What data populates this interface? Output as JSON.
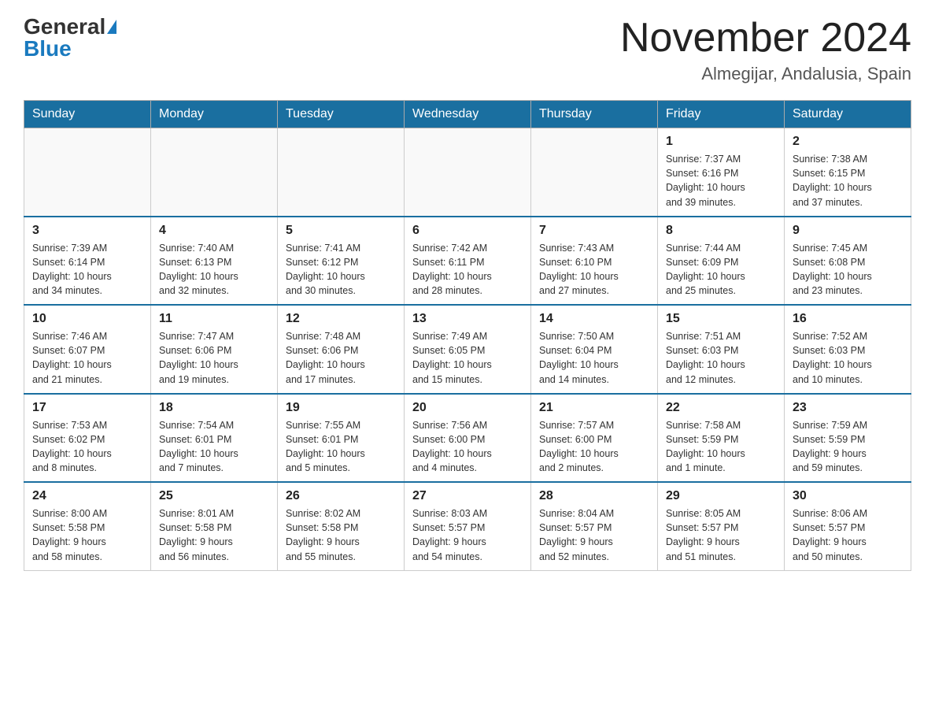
{
  "header": {
    "logo_general": "General",
    "logo_blue": "Blue",
    "month_title": "November 2024",
    "location": "Almegijar, Andalusia, Spain"
  },
  "days_of_week": [
    "Sunday",
    "Monday",
    "Tuesday",
    "Wednesday",
    "Thursday",
    "Friday",
    "Saturday"
  ],
  "weeks": [
    {
      "days": [
        {
          "num": "",
          "info": ""
        },
        {
          "num": "",
          "info": ""
        },
        {
          "num": "",
          "info": ""
        },
        {
          "num": "",
          "info": ""
        },
        {
          "num": "",
          "info": ""
        },
        {
          "num": "1",
          "info": "Sunrise: 7:37 AM\nSunset: 6:16 PM\nDaylight: 10 hours\nand 39 minutes."
        },
        {
          "num": "2",
          "info": "Sunrise: 7:38 AM\nSunset: 6:15 PM\nDaylight: 10 hours\nand 37 minutes."
        }
      ]
    },
    {
      "days": [
        {
          "num": "3",
          "info": "Sunrise: 7:39 AM\nSunset: 6:14 PM\nDaylight: 10 hours\nand 34 minutes."
        },
        {
          "num": "4",
          "info": "Sunrise: 7:40 AM\nSunset: 6:13 PM\nDaylight: 10 hours\nand 32 minutes."
        },
        {
          "num": "5",
          "info": "Sunrise: 7:41 AM\nSunset: 6:12 PM\nDaylight: 10 hours\nand 30 minutes."
        },
        {
          "num": "6",
          "info": "Sunrise: 7:42 AM\nSunset: 6:11 PM\nDaylight: 10 hours\nand 28 minutes."
        },
        {
          "num": "7",
          "info": "Sunrise: 7:43 AM\nSunset: 6:10 PM\nDaylight: 10 hours\nand 27 minutes."
        },
        {
          "num": "8",
          "info": "Sunrise: 7:44 AM\nSunset: 6:09 PM\nDaylight: 10 hours\nand 25 minutes."
        },
        {
          "num": "9",
          "info": "Sunrise: 7:45 AM\nSunset: 6:08 PM\nDaylight: 10 hours\nand 23 minutes."
        }
      ]
    },
    {
      "days": [
        {
          "num": "10",
          "info": "Sunrise: 7:46 AM\nSunset: 6:07 PM\nDaylight: 10 hours\nand 21 minutes."
        },
        {
          "num": "11",
          "info": "Sunrise: 7:47 AM\nSunset: 6:06 PM\nDaylight: 10 hours\nand 19 minutes."
        },
        {
          "num": "12",
          "info": "Sunrise: 7:48 AM\nSunset: 6:06 PM\nDaylight: 10 hours\nand 17 minutes."
        },
        {
          "num": "13",
          "info": "Sunrise: 7:49 AM\nSunset: 6:05 PM\nDaylight: 10 hours\nand 15 minutes."
        },
        {
          "num": "14",
          "info": "Sunrise: 7:50 AM\nSunset: 6:04 PM\nDaylight: 10 hours\nand 14 minutes."
        },
        {
          "num": "15",
          "info": "Sunrise: 7:51 AM\nSunset: 6:03 PM\nDaylight: 10 hours\nand 12 minutes."
        },
        {
          "num": "16",
          "info": "Sunrise: 7:52 AM\nSunset: 6:03 PM\nDaylight: 10 hours\nand 10 minutes."
        }
      ]
    },
    {
      "days": [
        {
          "num": "17",
          "info": "Sunrise: 7:53 AM\nSunset: 6:02 PM\nDaylight: 10 hours\nand 8 minutes."
        },
        {
          "num": "18",
          "info": "Sunrise: 7:54 AM\nSunset: 6:01 PM\nDaylight: 10 hours\nand 7 minutes."
        },
        {
          "num": "19",
          "info": "Sunrise: 7:55 AM\nSunset: 6:01 PM\nDaylight: 10 hours\nand 5 minutes."
        },
        {
          "num": "20",
          "info": "Sunrise: 7:56 AM\nSunset: 6:00 PM\nDaylight: 10 hours\nand 4 minutes."
        },
        {
          "num": "21",
          "info": "Sunrise: 7:57 AM\nSunset: 6:00 PM\nDaylight: 10 hours\nand 2 minutes."
        },
        {
          "num": "22",
          "info": "Sunrise: 7:58 AM\nSunset: 5:59 PM\nDaylight: 10 hours\nand 1 minute."
        },
        {
          "num": "23",
          "info": "Sunrise: 7:59 AM\nSunset: 5:59 PM\nDaylight: 9 hours\nand 59 minutes."
        }
      ]
    },
    {
      "days": [
        {
          "num": "24",
          "info": "Sunrise: 8:00 AM\nSunset: 5:58 PM\nDaylight: 9 hours\nand 58 minutes."
        },
        {
          "num": "25",
          "info": "Sunrise: 8:01 AM\nSunset: 5:58 PM\nDaylight: 9 hours\nand 56 minutes."
        },
        {
          "num": "26",
          "info": "Sunrise: 8:02 AM\nSunset: 5:58 PM\nDaylight: 9 hours\nand 55 minutes."
        },
        {
          "num": "27",
          "info": "Sunrise: 8:03 AM\nSunset: 5:57 PM\nDaylight: 9 hours\nand 54 minutes."
        },
        {
          "num": "28",
          "info": "Sunrise: 8:04 AM\nSunset: 5:57 PM\nDaylight: 9 hours\nand 52 minutes."
        },
        {
          "num": "29",
          "info": "Sunrise: 8:05 AM\nSunset: 5:57 PM\nDaylight: 9 hours\nand 51 minutes."
        },
        {
          "num": "30",
          "info": "Sunrise: 8:06 AM\nSunset: 5:57 PM\nDaylight: 9 hours\nand 50 minutes."
        }
      ]
    }
  ]
}
